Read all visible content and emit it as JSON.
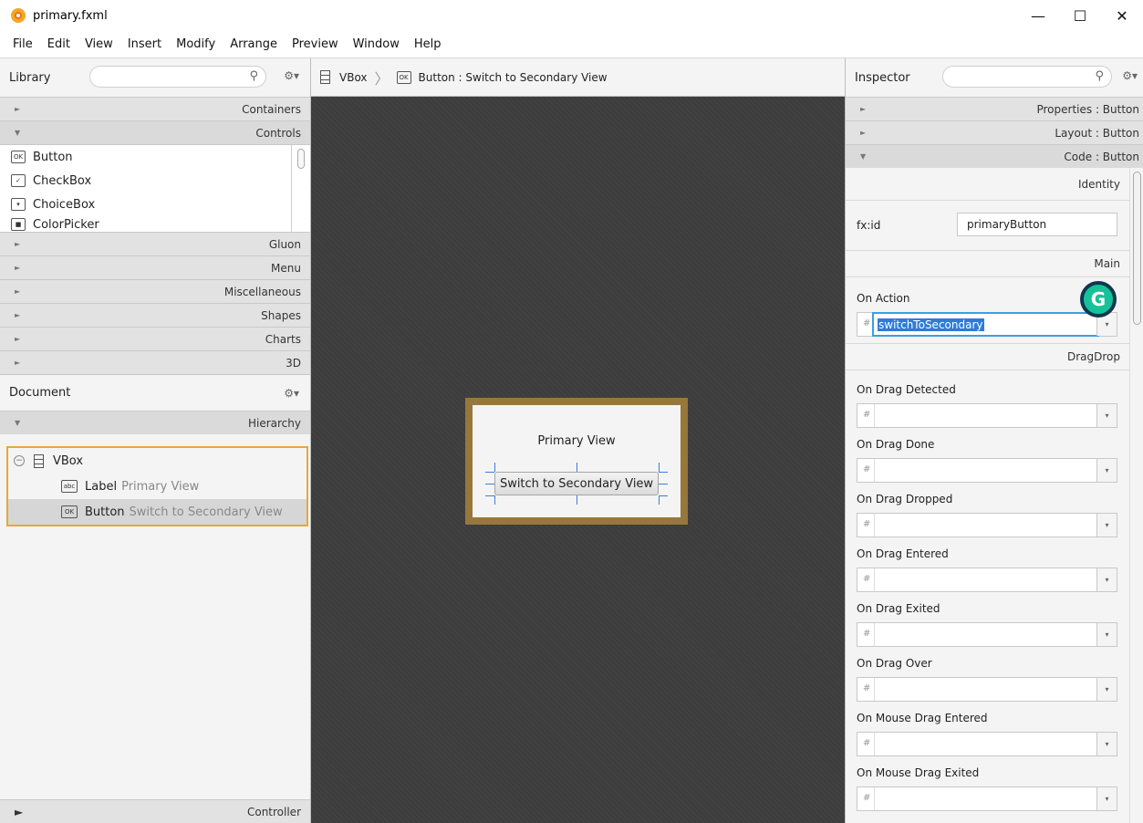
{
  "window": {
    "title": "primary.fxml",
    "minimize": "—",
    "maximize": "☐",
    "close": "✕"
  },
  "menu": [
    "File",
    "Edit",
    "View",
    "Insert",
    "Modify",
    "Arrange",
    "Preview",
    "Window",
    "Help"
  ],
  "library": {
    "title": "Library",
    "sections": {
      "containers": "Containers",
      "controls": "Controls",
      "gluon": "Gluon",
      "menu": "Menu",
      "misc": "Miscellaneous",
      "shapes": "Shapes",
      "charts": "Charts",
      "threed": "3D"
    },
    "controls": [
      {
        "label": "Button",
        "icon": "OK"
      },
      {
        "label": "CheckBox",
        "icon": "✓"
      },
      {
        "label": "ChoiceBox",
        "icon": "▾"
      },
      {
        "label": "ColorPicker",
        "icon": "■"
      }
    ]
  },
  "document": {
    "title": "Document",
    "hierarchy": "Hierarchy",
    "controller": "Controller",
    "tree": {
      "vbox": "VBox",
      "label_type": "Label",
      "label_text": "Primary View",
      "label_icon": "abc",
      "button_type": "Button",
      "button_text": "Switch to Secondary View",
      "button_icon": "OK"
    }
  },
  "breadcrumb": {
    "vbox": "VBox",
    "button": "Button : Switch to Secondary View",
    "button_icon": "OK"
  },
  "canvas": {
    "label": "Primary View",
    "button": "Switch to Secondary View"
  },
  "inspector": {
    "title": "Inspector",
    "properties": "Properties : Button",
    "layout": "Layout : Button",
    "code": "Code : Button",
    "identity": "Identity",
    "fxid_label": "fx:id",
    "fxid_value": "primaryButton",
    "main": "Main",
    "on_action_label": "On Action",
    "on_action_value": "switchToSecondary",
    "dragdrop": "DragDrop",
    "events": [
      "On Drag Detected",
      "On Drag Done",
      "On Drag Dropped",
      "On Drag Entered",
      "On Drag Exited",
      "On Drag Over",
      "On Mouse Drag Entered",
      "On Mouse Drag Exited"
    ],
    "hash": "#"
  },
  "icons": {
    "search": "⚲",
    "gear": "⚙▾",
    "collapse": "−",
    "arrow_right": "►",
    "arrow_down": "▼",
    "chevron_down": "▾",
    "grammarly": "G"
  }
}
